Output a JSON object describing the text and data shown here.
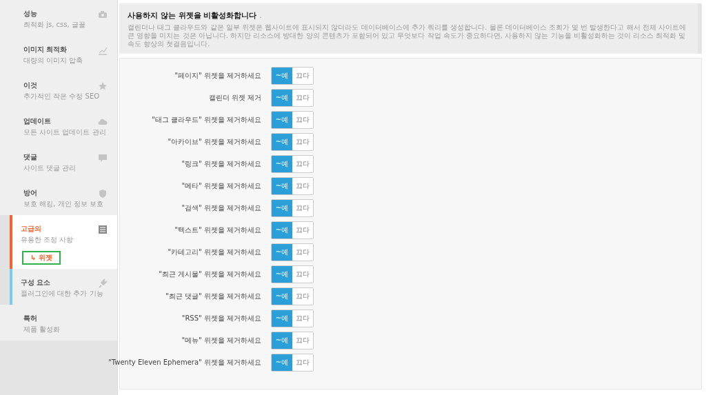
{
  "sidebar": {
    "items": [
      {
        "title": "성능",
        "subtitle": "최적화 js, css, 글꼴",
        "kind": "camera",
        "selected": false,
        "focused": false
      },
      {
        "title": "이미지 최적화",
        "subtitle": "대량의 이미지 압축",
        "kind": "chart",
        "selected": false,
        "focused": false
      },
      {
        "title": "이것",
        "subtitle": "추가적인 작은 수정 SEO",
        "kind": "star",
        "selected": false,
        "focused": false
      },
      {
        "title": "업데이트",
        "subtitle": "모든 사이트 업데이트 관리",
        "kind": "cloud",
        "selected": false,
        "focused": false
      },
      {
        "title": "댓글",
        "subtitle": "사이트 댓글 관리",
        "kind": "comment",
        "selected": false,
        "focused": false
      },
      {
        "title": "방어",
        "subtitle": "보호 해킹, 개인 정보 보호",
        "kind": "shield",
        "selected": false,
        "focused": false
      },
      {
        "title": "고급의",
        "subtitle": "유용한 조정 사항",
        "kind": "list",
        "selected": true,
        "focused": false,
        "children": [
          {
            "label": "↳ 위젯",
            "selected": true,
            "outlined": true
          }
        ]
      },
      {
        "title": "구성 요소",
        "subtitle": "플러그인에 대한 추가 기능",
        "kind": "plug",
        "selected": false,
        "focused": true
      },
      {
        "title": "특허",
        "subtitle": "제품 활성화",
        "kind": "plain",
        "selected": false,
        "focused": false
      }
    ]
  },
  "header": {
    "title": "사용하지 않는 위젯을 비활성화합니다",
    "title_suffix": ".",
    "description": "캘린더나 태그 클라우드와 같은 일부 위젯은 웹사이트에 표시되지 않더라도 데이터베이스에 추가 쿼리를 생성합니다. 물론 데이터베이스 조회가 몇 번 발생한다고 해서 전체 사이트에 큰 영향을 미치는 것은 아닙니다. 하지만 리소스에 방대한 양의 콘텐츠가 포함되어 있고 무엇보다 작업 속도가 중요하다면, 사용하지 않는 기능을 비활성화하는 것이 리소스 최적화 및 속도 향상의 첫걸음입니다."
  },
  "settings": [
    {
      "label": "\"페이지\" 위젯을 제거하세요",
      "on_label": "~예",
      "off_label": "끄다",
      "on": true
    },
    {
      "label": "캘린더 위젯 제거",
      "on_label": "~예",
      "off_label": "끄다",
      "on": true
    },
    {
      "label": "\"태그 클라우드\" 위젯을 제거하세요",
      "on_label": "~예",
      "off_label": "끄다",
      "on": true
    },
    {
      "label": "\"아카이브\" 위젯을 제거하세요",
      "on_label": "~예",
      "off_label": "끄다",
      "on": true
    },
    {
      "label": "\"링크\" 위젯을 제거하세요",
      "on_label": "~예",
      "off_label": "끄다",
      "on": true
    },
    {
      "label": "\"메타\" 위젯을 제거하세요",
      "on_label": "~예",
      "off_label": "끄다",
      "on": true
    },
    {
      "label": "\"검색\" 위젯을 제거하세요",
      "on_label": "~예",
      "off_label": "끄다",
      "on": true
    },
    {
      "label": "\"텍스트\" 위젯을 제거하세요",
      "on_label": "~예",
      "off_label": "끄다",
      "on": true
    },
    {
      "label": "\"카테고리\" 위젯을 제거하세요",
      "on_label": "~예",
      "off_label": "끄다",
      "on": true
    },
    {
      "label": "\"최근 게시물\" 위젯을 제거하세요",
      "on_label": "~예",
      "off_label": "끄다",
      "on": true
    },
    {
      "label": "\"최근 댓글\" 위젯을 제거하세요",
      "on_label": "~예",
      "off_label": "끄다",
      "on": true
    },
    {
      "label": "\"RSS\" 위젯을 제거하세요",
      "on_label": "~예",
      "off_label": "끄다",
      "on": true
    },
    {
      "label": "\"메뉴\" 위젯을 제거하세요",
      "on_label": "~예",
      "off_label": "끄다",
      "on": true
    },
    {
      "label": "\"Twenty Eleven Ephemera\" 위젯을 제거하세요",
      "on_label": "~예",
      "off_label": "끄다",
      "on": true
    }
  ]
}
